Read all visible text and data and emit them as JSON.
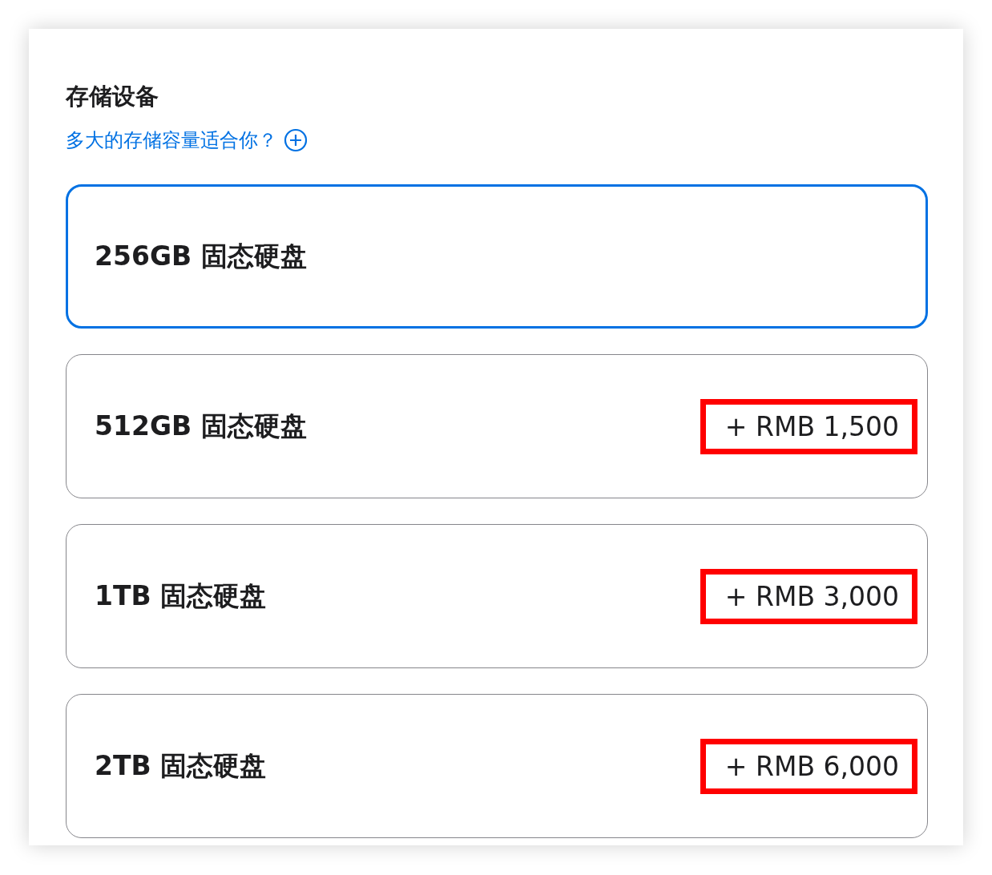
{
  "section": {
    "title": "存储设备",
    "help_link": "多大的存储容量适合你？"
  },
  "options": [
    {
      "label": "256GB 固态硬盘",
      "selected": true
    },
    {
      "label": "512GB 固态硬盘",
      "selected": false,
      "price": "+ RMB 1,500",
      "highlighted": true
    },
    {
      "label": "1TB 固态硬盘",
      "selected": false,
      "price": "+ RMB 3,000",
      "highlighted": true
    },
    {
      "label": "2TB 固态硬盘",
      "selected": false,
      "price": "+ RMB 6,000",
      "highlighted": true
    }
  ]
}
